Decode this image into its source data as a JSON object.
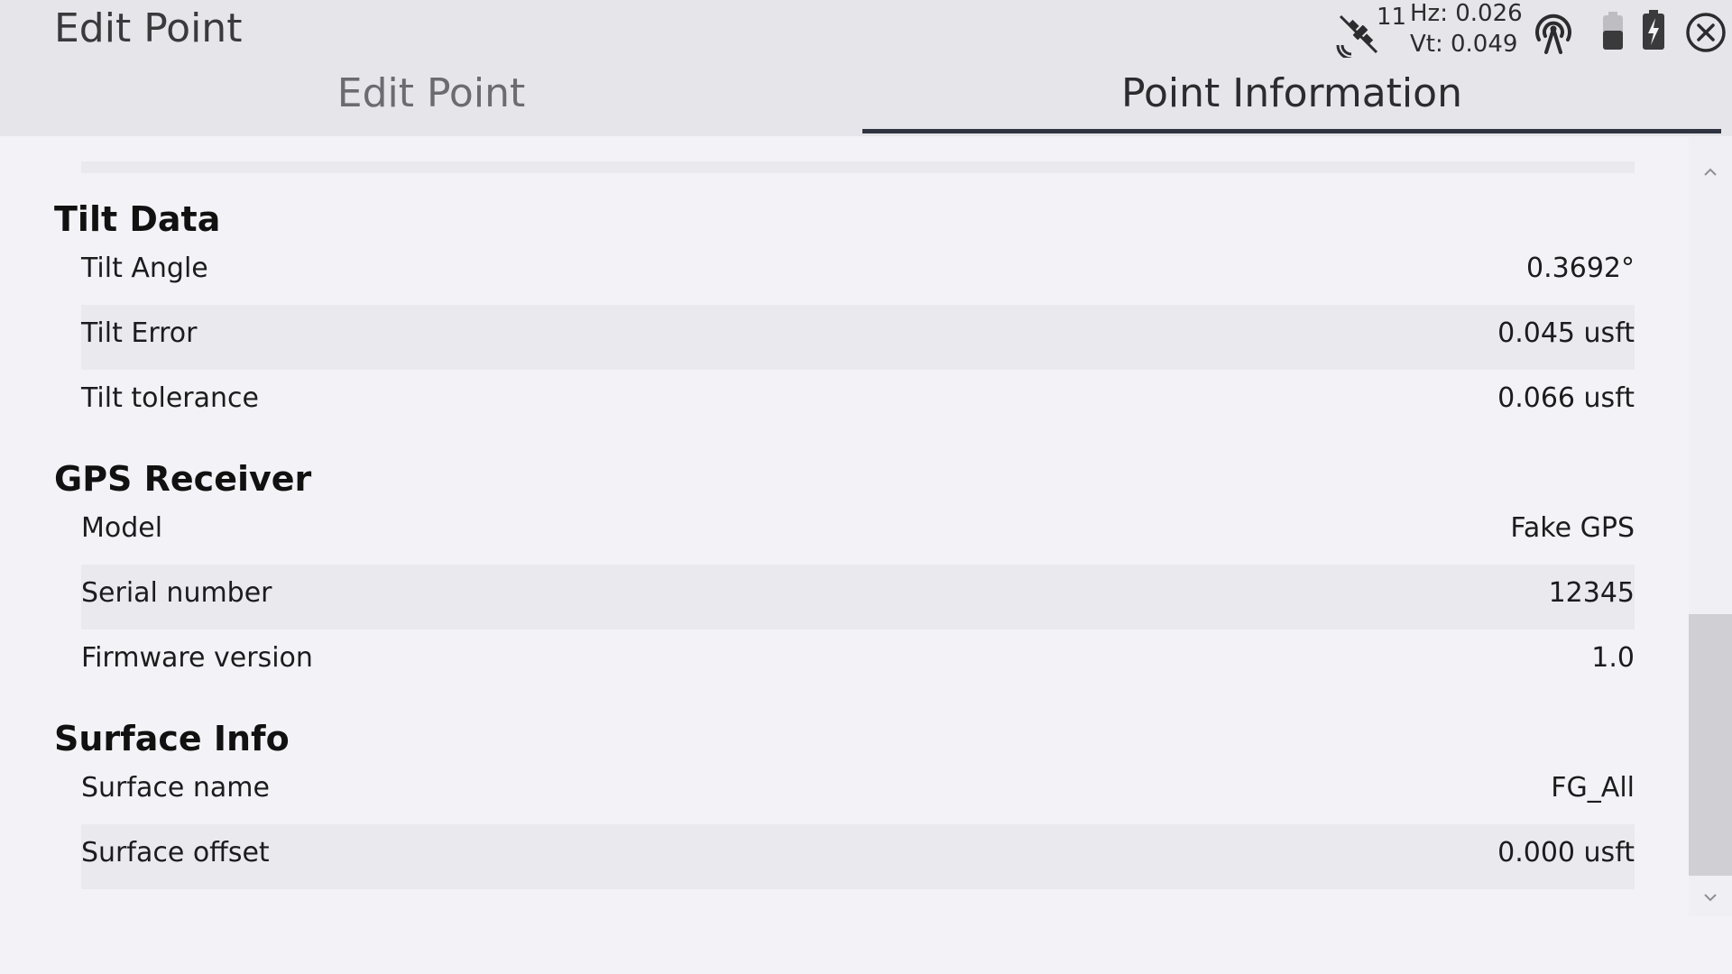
{
  "window": {
    "title": "Edit Point"
  },
  "status": {
    "satellite_count": "11",
    "hz": "Hz: 0.026",
    "vt": "Vt: 0.049",
    "icons": [
      "satellite-icon",
      "antenna-icon",
      "battery-icon",
      "battery-charging-icon",
      "close-icon"
    ]
  },
  "tabs": [
    {
      "label": "Edit Point",
      "active": false
    },
    {
      "label": "Point Information",
      "active": true
    }
  ],
  "sections": [
    {
      "title": "Tilt Data",
      "rows": [
        {
          "label": "Tilt Angle",
          "value": "0.3692°"
        },
        {
          "label": "Tilt Error",
          "value": "0.045 usft"
        },
        {
          "label": "Tilt tolerance",
          "value": "0.066 usft"
        }
      ]
    },
    {
      "title": "GPS Receiver",
      "rows": [
        {
          "label": "Model",
          "value": "Fake GPS"
        },
        {
          "label": "Serial number",
          "value": "12345"
        },
        {
          "label": "Firmware version",
          "value": "1.0"
        }
      ]
    },
    {
      "title": "Surface Info",
      "rows": [
        {
          "label": "Surface name",
          "value": "FG_All"
        },
        {
          "label": "Surface offset",
          "value": "0.000 usft"
        }
      ]
    }
  ],
  "colors": {
    "header_bg": "#e5e5ea",
    "content_bg": "#f3f3f7",
    "alt_row_bg": "#e9e9ee",
    "tab_indicator": "#2f3440"
  }
}
